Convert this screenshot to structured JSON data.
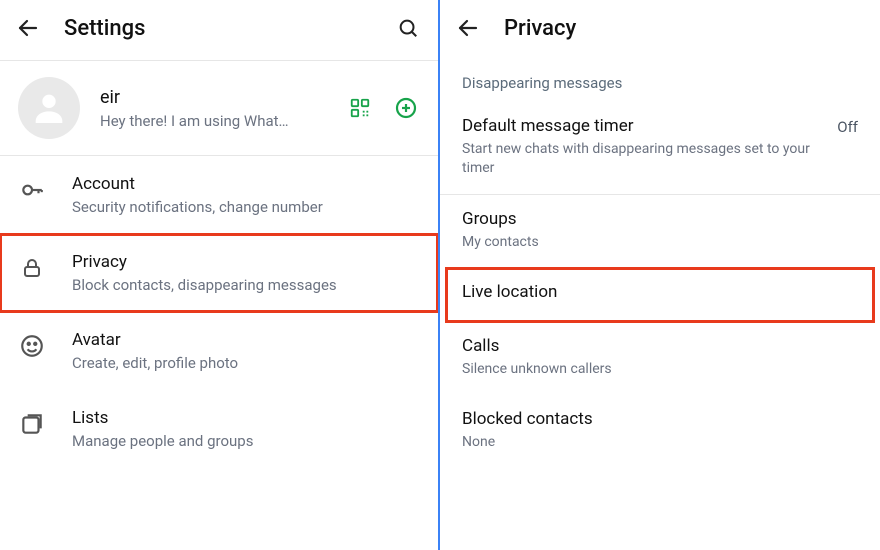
{
  "left": {
    "title": "Settings",
    "profile": {
      "name": "eir",
      "status": "Hey there! I am using What…"
    },
    "items": [
      {
        "icon": "key",
        "title": "Account",
        "sub": "Security notifications, change number"
      },
      {
        "icon": "lock",
        "title": "Privacy",
        "sub": "Block contacts, disappearing messages",
        "highlight": true
      },
      {
        "icon": "avatar-face",
        "title": "Avatar",
        "sub": "Create, edit, profile photo"
      },
      {
        "icon": "lists",
        "title": "Lists",
        "sub": "Manage people and groups"
      }
    ]
  },
  "right": {
    "title": "Privacy",
    "section_header": "Disappearing messages",
    "default_timer": {
      "title": "Default message timer",
      "sub": "Start new chats with disappearing messages set to your timer",
      "value": "Off"
    },
    "items": [
      {
        "title": "Groups",
        "sub": "My contacts"
      },
      {
        "title": "Live location",
        "sub": "",
        "highlight": true
      },
      {
        "title": "Calls",
        "sub": "Silence unknown callers"
      },
      {
        "title": "Blocked contacts",
        "sub": "None"
      }
    ]
  }
}
